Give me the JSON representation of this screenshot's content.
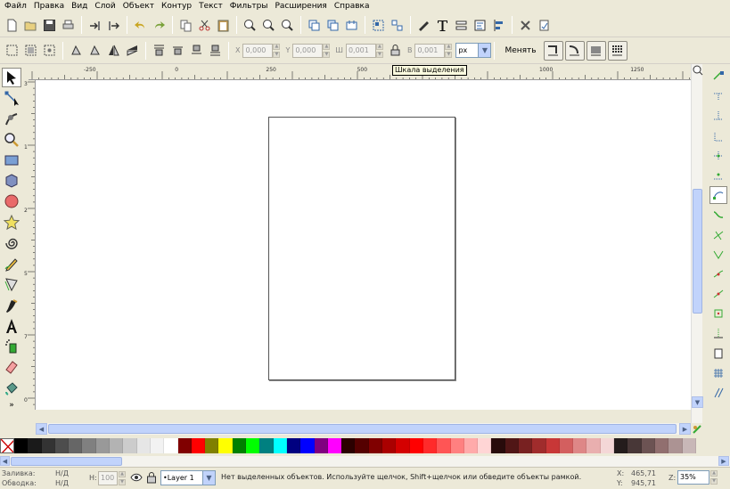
{
  "menubar": {
    "items": [
      "Файл",
      "Правка",
      "Вид",
      "Слой",
      "Объект",
      "Контур",
      "Текст",
      "Фильтры",
      "Расширения",
      "Справка"
    ]
  },
  "toolbar1": {
    "icons": [
      "new-document-icon",
      "open-icon",
      "save-icon",
      "print-icon",
      "import-icon",
      "export-icon",
      "undo-icon",
      "redo-icon",
      "copy-icon",
      "cut-icon",
      "paste-icon",
      "zoom-selection-icon",
      "zoom-drawing-icon",
      "zoom-page-icon",
      "duplicate-icon",
      "clone-icon",
      "unlink-clone-icon",
      "group-icon",
      "ungroup-icon",
      "fill-stroke-icon",
      "text-font-icon",
      "layers-icon",
      "xml-editor-icon",
      "align-distribute-icon",
      "preferences-icon",
      "document-properties-icon"
    ]
  },
  "toolbar2": {
    "x_label": "X",
    "x_value": "0,000",
    "y_label": "Y",
    "y_value": "0,000",
    "w_label": "Ш",
    "w_value": "0,001",
    "h_label": "В",
    "h_value": "0,001",
    "unit": "px",
    "scale_label": "Менять"
  },
  "ruler": {
    "tooltip": "Шкала выделения",
    "h_ticks": [
      "-250",
      "0",
      "250",
      "500",
      "750",
      "1000",
      "1250"
    ],
    "v_ticks": [
      "3",
      "1",
      "2",
      "5",
      "7",
      "0"
    ]
  },
  "palette": {
    "colors": [
      "#000000",
      "#1a1a1a",
      "#333333",
      "#4d4d4d",
      "#666666",
      "#808080",
      "#999999",
      "#b3b3b3",
      "#cccccc",
      "#e6e6e6",
      "#f2f2f2",
      "#ffffff",
      "#800000",
      "#ff0000",
      "#808000",
      "#ffff00",
      "#008000",
      "#00ff00",
      "#008080",
      "#00ffff",
      "#000080",
      "#0000ff",
      "#800080",
      "#ff00ff",
      "#2b0000",
      "#550000",
      "#800000",
      "#aa0000",
      "#d40000",
      "#ff0000",
      "#ff2a2a",
      "#ff5555",
      "#ff8080",
      "#ffaaaa",
      "#ffd5d5",
      "#280b0b",
      "#501616",
      "#782121",
      "#a02c2c",
      "#c83737",
      "#d35f5f",
      "#de8787",
      "#e9afaf",
      "#f4d7d7",
      "#241c1c",
      "#483737",
      "#6c5353",
      "#916f6f",
      "#ac9393",
      "#c8b7b7"
    ]
  },
  "statusbar": {
    "fill_label": "Заливка:",
    "fill_value": "Н/Д",
    "stroke_label": "Обводка:",
    "stroke_value": "Н/Д",
    "opacity_label": "H:",
    "opacity_value": "100",
    "layer": "•Layer 1",
    "message": "Нет выделенных объектов. Используйте щелчок, Shift+щелчок или обведите объекты рамкой.",
    "x_label": "X:",
    "x_value": "465,71",
    "y_label": "Y:",
    "y_value": "945,71",
    "zoom_label": "Z:",
    "zoom_value": "35%"
  }
}
